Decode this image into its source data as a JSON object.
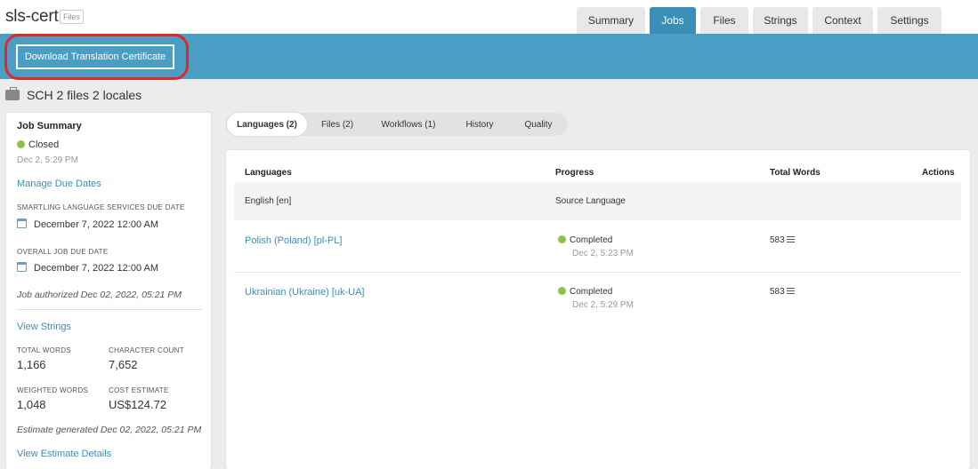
{
  "header": {
    "project_title": "sls-cert",
    "files_badge": "Files",
    "tabs": [
      {
        "label": "Summary"
      },
      {
        "label": "Jobs"
      },
      {
        "label": "Files"
      },
      {
        "label": "Strings"
      },
      {
        "label": "Context"
      },
      {
        "label": "Settings"
      }
    ],
    "active_tab": "Jobs"
  },
  "action_bar": {
    "download_label": "Download Translation Certificate"
  },
  "job": {
    "title": "SCH 2 files 2 locales"
  },
  "summary": {
    "heading": "Job Summary",
    "status": "Closed",
    "status_date": "Dec 2, 5:29 PM",
    "manage_due_dates": "Manage Due Dates",
    "sls_due_label": "SMARTLING LANGUAGE SERVICES DUE DATE",
    "sls_due_value": "December 7, 2022 12:00 AM",
    "overall_due_label": "OVERALL JOB DUE DATE",
    "overall_due_value": "December 7, 2022 12:00 AM",
    "authorized": "Job authorized Dec 02, 2022, 05:21 PM",
    "view_strings": "View Strings",
    "total_words_label": "TOTAL WORDS",
    "total_words_value": "1,166",
    "char_count_label": "CHARACTER COUNT",
    "char_count_value": "7,652",
    "weighted_words_label": "WEIGHTED WORDS",
    "weighted_words_value": "1,048",
    "cost_estimate_label": "COST ESTIMATE",
    "cost_estimate_value": "US$124.72",
    "estimate_generated": "Estimate generated Dec 02, 2022, 05:21 PM",
    "view_estimate": "View Estimate Details"
  },
  "sub_tabs": [
    {
      "label": "Languages (2)"
    },
    {
      "label": "Files (2)"
    },
    {
      "label": "Workflows (1)"
    },
    {
      "label": "History"
    },
    {
      "label": "Quality"
    }
  ],
  "table": {
    "columns": {
      "languages": "Languages",
      "progress": "Progress",
      "total_words": "Total Words",
      "actions": "Actions"
    },
    "source_row": {
      "language": "English [en]",
      "progress": "Source Language"
    },
    "rows": [
      {
        "language": "Polish (Poland) [pl-PL]",
        "status": "Completed",
        "date": "Dec 2, 5:23 PM",
        "words": "583"
      },
      {
        "language": "Ukrainian (Ukraine) [uk-UA]",
        "status": "Completed",
        "date": "Dec 2, 5:29 PM",
        "words": "583"
      }
    ]
  },
  "colors": {
    "accent": "#4a9ec3",
    "active_tab": "#3a8fb7",
    "link": "#3a8fb7",
    "highlight": "#e4262b",
    "success": "#8bc34a"
  }
}
